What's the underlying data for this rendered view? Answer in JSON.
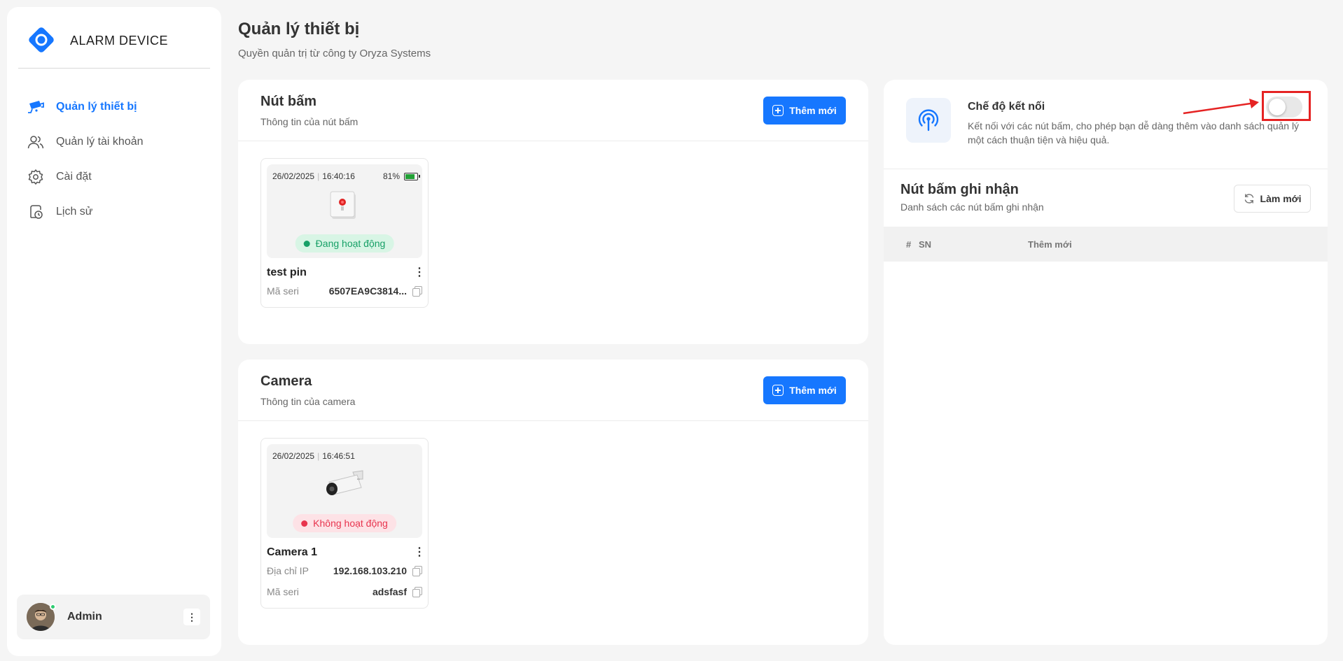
{
  "sidebar": {
    "brand": "ALARM DEVICE",
    "items": [
      {
        "label": "Quản lý thiết bị",
        "icon": "cctv-camera-icon",
        "active": true
      },
      {
        "label": "Quản lý tài khoản",
        "icon": "users-icon",
        "active": false
      },
      {
        "label": "Cài đặt",
        "icon": "gear-icon",
        "active": false
      },
      {
        "label": "Lịch sử",
        "icon": "history-icon",
        "active": false
      }
    ],
    "user": {
      "name": "Admin",
      "menu": "⋮"
    }
  },
  "header": {
    "title": "Quản lý thiết bị",
    "subtitle": "Quyền quản trị từ công ty Oryza Systems"
  },
  "buttons_card": {
    "title": "Nút bấm",
    "subtitle": "Thông tin của nút bấm",
    "add_label": "Thêm mới",
    "device": {
      "date": "26/02/2025",
      "time": "16:40:16",
      "battery": "81%",
      "battery_level": 0.81,
      "status": "Đang hoạt động",
      "name": "test pin",
      "serial_label": "Mã seri",
      "serial": "6507EA9C3814...",
      "menu": "⋮"
    }
  },
  "camera_card": {
    "title": "Camera",
    "subtitle": "Thông tin của camera",
    "add_label": "Thêm mới",
    "device": {
      "date": "26/02/2025",
      "time": "16:46:51",
      "status": "Không hoạt động",
      "name": "Camera 1",
      "ip_label": "Địa chỉ IP",
      "ip": "192.168.103.210",
      "serial_label": "Mã seri",
      "serial": "adsfasf",
      "menu": "⋮"
    }
  },
  "connection": {
    "title": "Chế độ kết nối",
    "description": "Kết nối với các nút bấm, cho phép bạn dễ dàng thêm vào danh sách quản lý một cách thuận tiện và hiệu quả.",
    "enabled": false
  },
  "recorded": {
    "title": "Nút bấm ghi nhận",
    "subtitle": "Danh sách các nút bấm ghi nhận",
    "refresh_label": "Làm mới",
    "columns": [
      "#",
      "SN",
      "Thêm mới"
    ],
    "rows": []
  },
  "colors": {
    "accent": "#1677ff",
    "active_green": "#17a067",
    "inactive_red": "#e8344e",
    "annotation_red": "#e52323"
  }
}
